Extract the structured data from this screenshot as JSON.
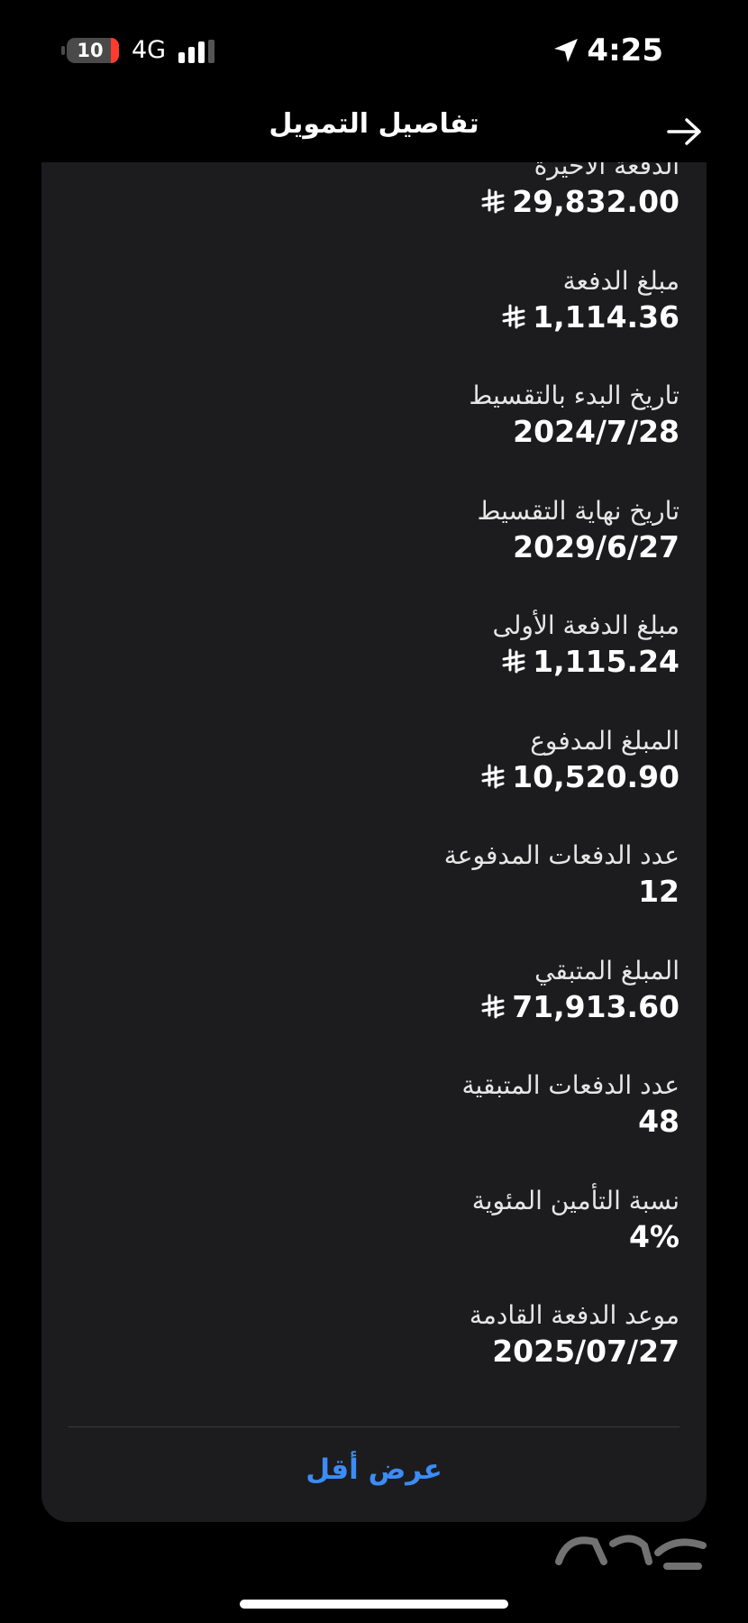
{
  "status_bar": {
    "battery_level": "10",
    "network": "4G",
    "time": "4:25"
  },
  "nav": {
    "title": "تفاصيل التمويل"
  },
  "details": [
    {
      "label": "الدفعة الأخيرة",
      "value": "29,832.00",
      "currency": true
    },
    {
      "label": "مبلغ الدفعة",
      "value": "1,114.36",
      "currency": true
    },
    {
      "label": "تاريخ البدء بالتقسيط",
      "value": "2024/7/28",
      "currency": false
    },
    {
      "label": "تاريخ نهاية التقسيط",
      "value": "2029/6/27",
      "currency": false
    },
    {
      "label": "مبلغ الدفعة الأولى",
      "value": "1,115.24",
      "currency": true
    },
    {
      "label": "المبلغ المدفوع",
      "value": "10,520.90",
      "currency": true
    },
    {
      "label": "عدد الدفعات المدفوعة",
      "value": "12",
      "currency": false
    },
    {
      "label": "المبلغ المتبقي",
      "value": "71,913.60",
      "currency": true
    },
    {
      "label": "عدد الدفعات المتبقية",
      "value": "48",
      "currency": false
    },
    {
      "label": "نسبة التأمين المئوية",
      "value": "4%",
      "currency": false
    },
    {
      "label": "موعد الدفعة القادمة",
      "value": "2025/07/27",
      "currency": false
    }
  ],
  "footer": {
    "show_less_label": "عرض أقل"
  },
  "colors": {
    "background": "#000000",
    "sheet": "#1c1c1e",
    "link": "#3b8cf5",
    "battery_low": "#ff3b30"
  },
  "icons": [
    "location-arrow-icon",
    "signal-bars-icon",
    "battery-icon",
    "back-arrow-icon",
    "riyal-icon",
    "haraj-watermark-logo"
  ]
}
